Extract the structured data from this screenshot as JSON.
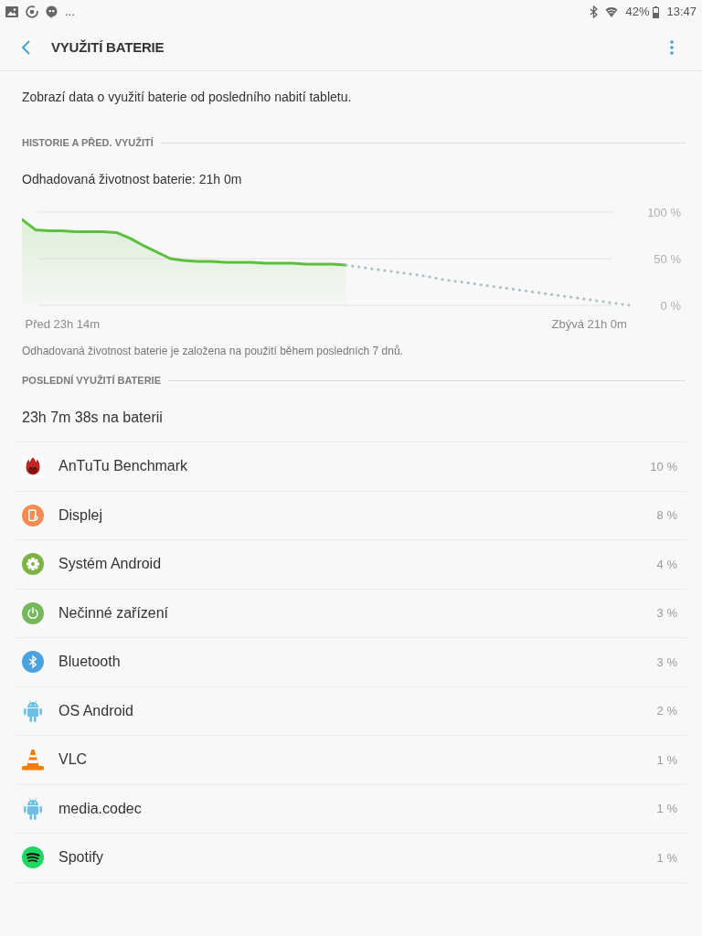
{
  "status_bar": {
    "overflow": "...",
    "battery": "42%",
    "time": "13:47"
  },
  "app_bar": {
    "title": "VYUŽITÍ BATERIE"
  },
  "description": "Zobrazí data o využití baterie od posledního nabití tabletu.",
  "history": {
    "header": "HISTORIE A PŘED. VYUŽITÍ",
    "estimate": "Odhadovaná životnost baterie: 21h 0m",
    "chart_data": {
      "type": "line",
      "categories": [
        null,
        null,
        null,
        "Před 23h 14m",
        null,
        null,
        null,
        null,
        null,
        null,
        null,
        null,
        null,
        null,
        null,
        null,
        null,
        null,
        null,
        null,
        null,
        null,
        null,
        null,
        null,
        null,
        null,
        null,
        null,
        null,
        null,
        null,
        null,
        null,
        null,
        null,
        null,
        null,
        null,
        null,
        null,
        null,
        "Zbývá 21h 0m",
        null,
        null,
        null
      ],
      "series": [
        {
          "color": "#5cbf3e",
          "values": [
            92,
            81,
            80,
            80,
            79,
            79,
            79,
            78,
            72,
            64,
            57,
            50,
            48,
            47,
            47,
            46,
            46,
            46,
            45,
            45,
            45,
            44,
            44,
            44,
            43,
            null,
            null,
            null,
            null,
            null,
            null,
            null,
            null,
            null,
            null,
            null,
            null,
            null,
            null,
            null,
            null,
            null,
            null,
            null,
            null,
            null
          ]
        },
        {
          "color": "#a9bfc6",
          "line_style": "dotted",
          "values": [
            null,
            null,
            null,
            null,
            null,
            null,
            null,
            null,
            null,
            null,
            null,
            null,
            null,
            null,
            null,
            null,
            null,
            null,
            null,
            null,
            null,
            null,
            null,
            null,
            43,
            41,
            39,
            37,
            35,
            33,
            31,
            28,
            26,
            24,
            22,
            20,
            18,
            16,
            14,
            12,
            10,
            8,
            6,
            4,
            2,
            0
          ]
        }
      ],
      "ylim": [
        0,
        100
      ],
      "yticks": [
        {
          "value": 0,
          "label": "0 %"
        },
        {
          "value": 50,
          "label": "50 %"
        },
        {
          "value": 100,
          "label": "100 %"
        }
      ]
    },
    "note": "Odhadovaná životnost baterie je založena na použití během posledních 7 dnů."
  },
  "recent": {
    "header": "POSLEDNÍ VYUŽITÍ BATERIE",
    "total": "23h 7m 38s na baterii",
    "apps": [
      {
        "name": "AnTuTu Benchmark",
        "percent": "10 %"
      },
      {
        "name": "Displej",
        "percent": "8 %"
      },
      {
        "name": "Systém Android",
        "percent": "4 %"
      },
      {
        "name": "Nečinné zařízení",
        "percent": "3 %"
      },
      {
        "name": "Bluetooth",
        "percent": "3 %"
      },
      {
        "name": "OS Android",
        "percent": "2 %"
      },
      {
        "name": "VLC",
        "percent": "1 %"
      },
      {
        "name": "media.codec",
        "percent": "1 %"
      },
      {
        "name": "Spotify",
        "percent": "1 %"
      }
    ]
  }
}
